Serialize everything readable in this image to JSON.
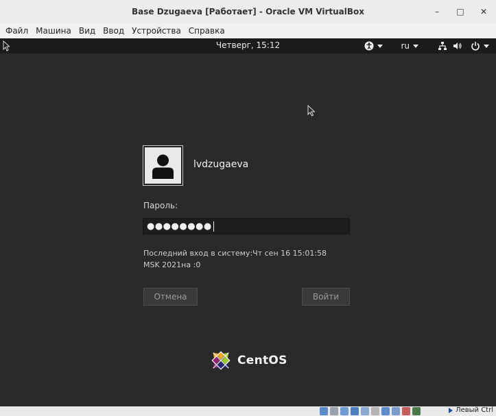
{
  "window": {
    "title": "Base Dzugaeva [Работает] - Oracle VM VirtualBox",
    "controls": [
      "–",
      "□",
      "✕"
    ]
  },
  "menu": [
    "Файл",
    "Машина",
    "Вид",
    "Ввод",
    "Устройства",
    "Справка"
  ],
  "gnome": {
    "clock": "Четверг, 15:12",
    "keyboard_layout": "ru",
    "icons": [
      "accessibility-icon",
      "network-icon",
      "volume-icon",
      "power-icon"
    ]
  },
  "login": {
    "username": "lvdzugaeva",
    "password_label": "Пароль:",
    "password_value": "●●●●●●●●",
    "last_login_line1": "Последний вход в систему:Чт сен 16 15:01:58",
    "last_login_line2": "MSK 2021на :0",
    "cancel_label": "Отмена",
    "login_label": "Войти"
  },
  "branding": {
    "name": "CentOS"
  },
  "statusbar": {
    "host_key": "Левый Ctrl"
  },
  "colors": {
    "vm_background": "#2a2a2a",
    "topbar": "#1c1c1c",
    "accent_blue": "#1a4f9a"
  }
}
